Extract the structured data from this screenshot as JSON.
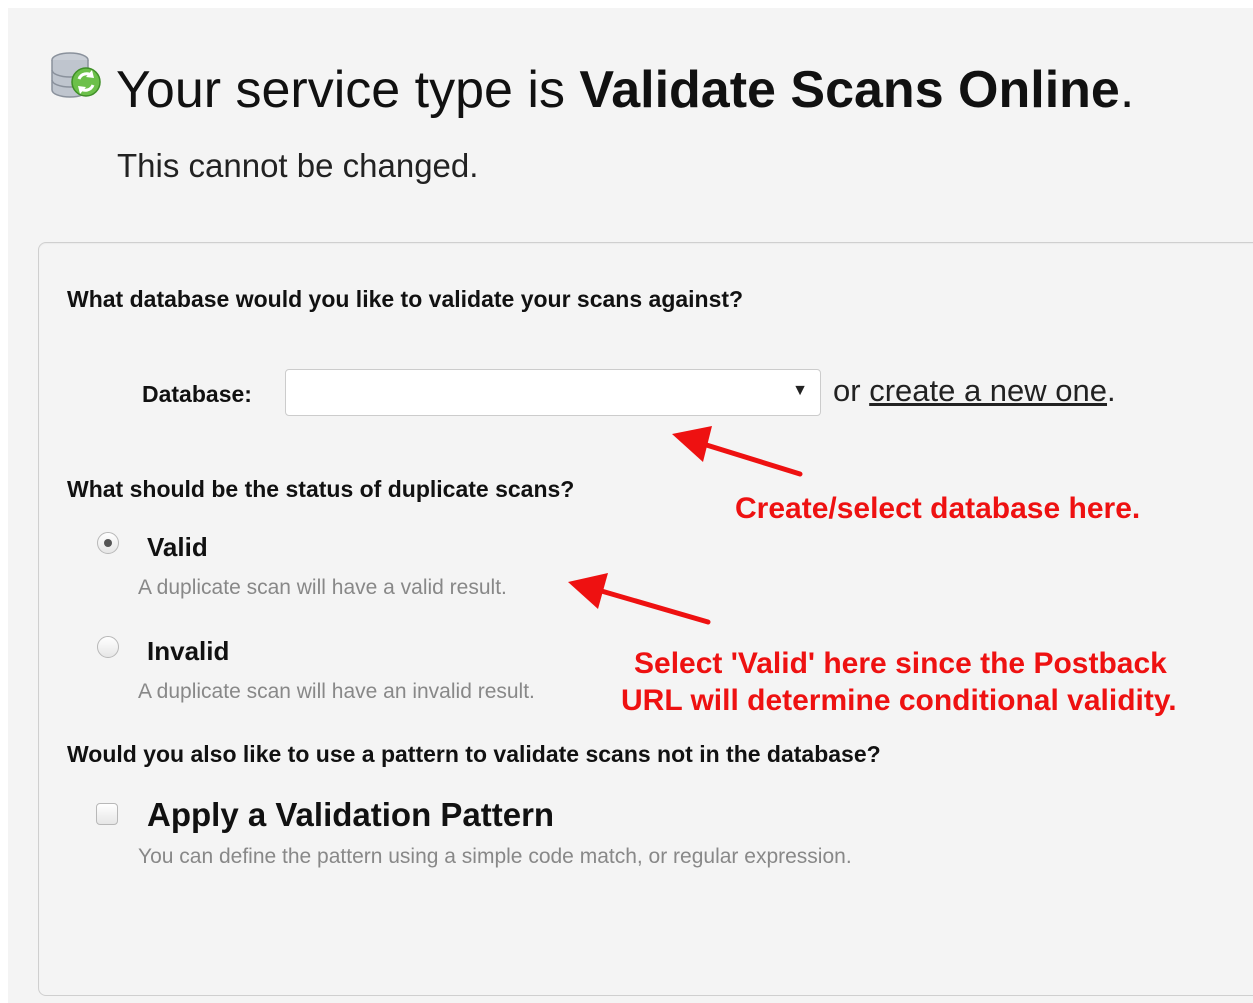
{
  "header": {
    "title_prefix": "Your service type is ",
    "title_service": "Validate Scans Online",
    "title_suffix": ".",
    "subtitle": "This cannot be changed.",
    "icon": "database-sync-icon"
  },
  "database_section": {
    "question": "What database would you like to validate your scans against?",
    "label": "Database:",
    "selected_value": "",
    "caret": "▼",
    "or_text": "or ",
    "create_link": "create a new one",
    "after_link": "."
  },
  "duplicate_section": {
    "question": "What should be the status of duplicate scans?",
    "options": [
      {
        "label": "Valid",
        "help": "A duplicate scan will have a valid result.",
        "checked": true
      },
      {
        "label": "Invalid",
        "help": "A duplicate scan will have an invalid result.",
        "checked": false
      }
    ]
  },
  "pattern_section": {
    "question": "Would you also like to use a pattern to validate scans not in the database?",
    "checkbox_label": "Apply a Validation Pattern",
    "checked": false,
    "help": "You can define the pattern using a simple code match, or regular expression."
  },
  "annotations": {
    "database_note": "Create/select database here.",
    "valid_note_line1": "Select 'Valid' here since the Postback",
    "valid_note_line2": "URL will determine conditional validity.",
    "color": "#ee1111"
  }
}
